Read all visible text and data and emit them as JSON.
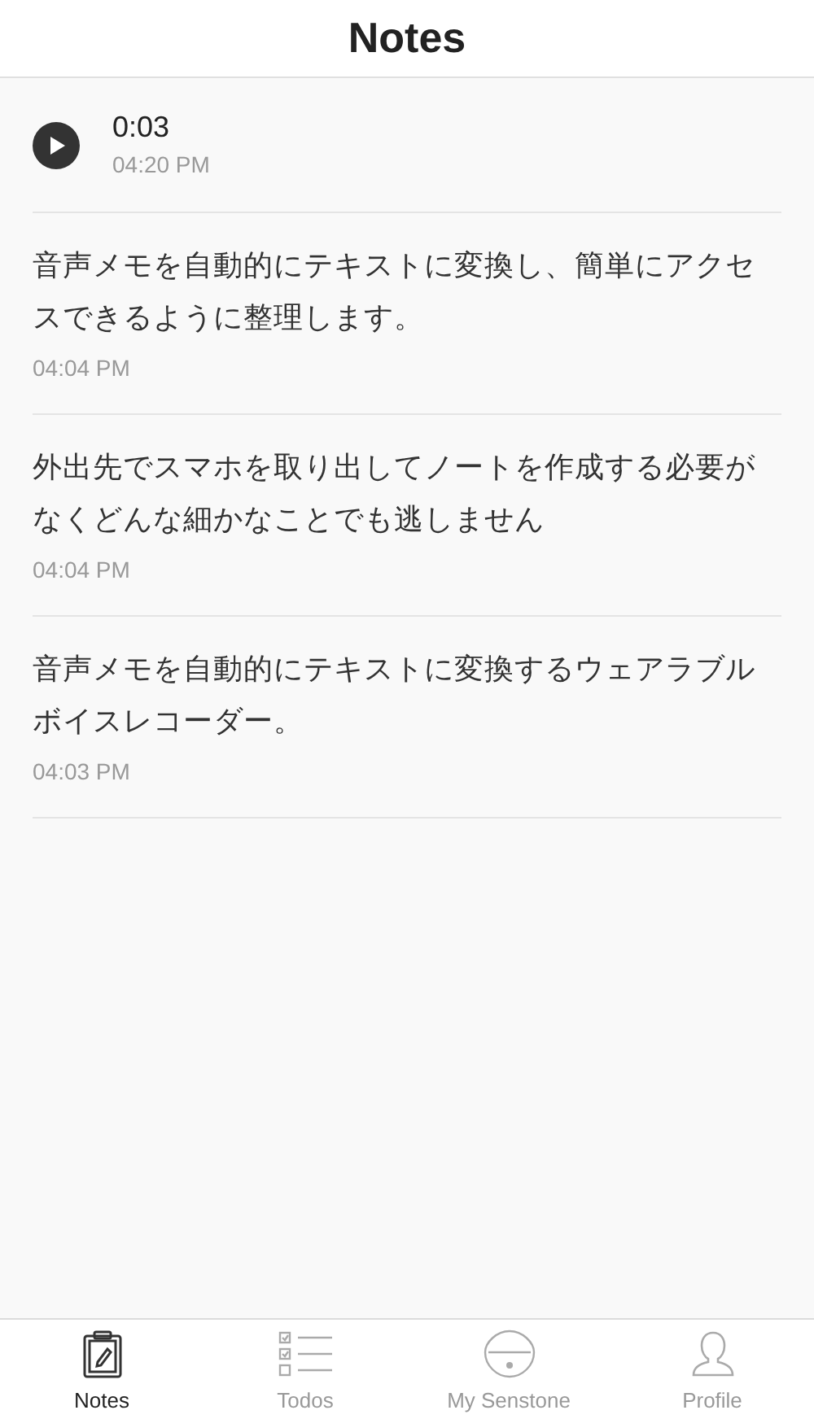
{
  "header": {
    "title": "Notes"
  },
  "notes": [
    {
      "kind": "audio",
      "duration": "0:03",
      "time": "04:20 PM"
    },
    {
      "kind": "text",
      "text": "音声メモを自動的にテキストに変換し、簡単にアクセスできるように整理します。",
      "time": "04:04 PM"
    },
    {
      "kind": "text",
      "text": "外出先でスマホを取り出してノートを作成する必要がなくどんな細かなことでも逃しません",
      "time": "04:04 PM"
    },
    {
      "kind": "text",
      "text": "音声メモを自動的にテキストに変換するウェアラブルボイスレコーダー。",
      "time": "04:03 PM"
    }
  ],
  "tabs": [
    {
      "label": "Notes",
      "kind": "notes",
      "selected": true
    },
    {
      "label": "Todos",
      "kind": "todos",
      "selected": false
    },
    {
      "label": "My Senstone",
      "kind": "device",
      "selected": false
    },
    {
      "label": "Profile",
      "kind": "profile",
      "selected": false
    }
  ]
}
